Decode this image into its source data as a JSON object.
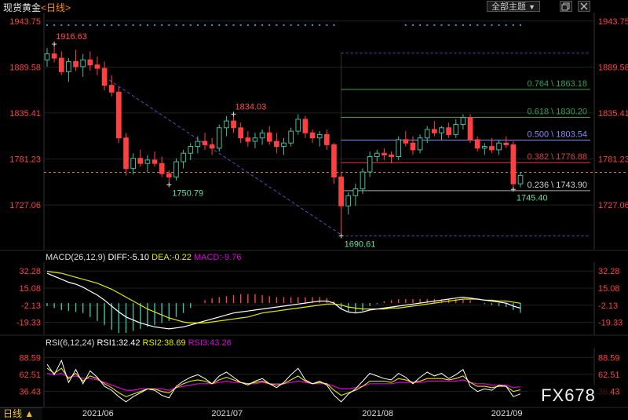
{
  "header": {
    "title": "现货黄金",
    "timeframe_link": "<日线>",
    "theme_label": "全部主题",
    "dropdown_glyph": "▼",
    "window_icons": [
      "restore-icon",
      "close-icon"
    ],
    "bottom_timeframe": "日线 ▲",
    "watermark": "FX678"
  },
  "colors": {
    "up": "#40c0a0",
    "down": "#ff4040",
    "macd_pos": "#ff4040",
    "macd_neg": "#40c0a0",
    "dif": "#ffffff",
    "dea": "#e8e800",
    "rsi1": "#ffffff",
    "rsi2": "#e8e800",
    "rsi3": "#e000e0",
    "axis_text": "#ff4040",
    "grid": "#202020"
  },
  "chart_data": [
    {
      "type": "candlestick",
      "panel": "price",
      "title": "现货黄金 <日线>",
      "y_ticks": [
        "1943.75",
        "1889.58",
        "1835.41",
        "1781.23",
        "1727.06"
      ],
      "ylim": [
        1680,
        1950
      ],
      "x_ticks": [
        "2021/06",
        "2021/07",
        "2021/08",
        "2021/09"
      ],
      "annotations": [
        {
          "label": "1916.63",
          "value": 1916.63,
          "kind": "high"
        },
        {
          "label": "1750.79",
          "value": 1750.79,
          "kind": "low"
        },
        {
          "label": "1690.61",
          "value": 1690.61,
          "kind": "low"
        },
        {
          "label": "1834.03",
          "value": 1834.03,
          "kind": "high"
        },
        {
          "label": "1745.40",
          "value": 1745.4,
          "kind": "low"
        }
      ],
      "fib_levels": [
        {
          "label": "0.764 \\ 1863.18",
          "value": 1863.18,
          "color": "#2ea35a"
        },
        {
          "label": "0.618 \\ 1830.20",
          "value": 1830.2,
          "color": "#2ea35a"
        },
        {
          "label": "0.500 \\ 1803.54",
          "value": 1803.54,
          "color": "#8a8aff"
        },
        {
          "label": "0.382 \\ 1776.88",
          "value": 1776.88,
          "color": "#e04040"
        },
        {
          "label": "0.236 \\ 1743.90",
          "value": 1743.9,
          "color": "#aaaaaa"
        }
      ],
      "fib_bounds": [
        1690.61,
        1906.0
      ],
      "current_price_line": 1765.5,
      "ohlc": [
        [
          1898,
          1912,
          1890,
          1905
        ],
        [
          1905,
          1916.6,
          1895,
          1900
        ],
        [
          1900,
          1908,
          1880,
          1884
        ],
        [
          1884,
          1900,
          1872,
          1896
        ],
        [
          1896,
          1910,
          1885,
          1890
        ],
        [
          1890,
          1905,
          1878,
          1898
        ],
        [
          1898,
          1908,
          1885,
          1892
        ],
        [
          1892,
          1902,
          1880,
          1888
        ],
        [
          1888,
          1896,
          1862,
          1868
        ],
        [
          1868,
          1880,
          1855,
          1860
        ],
        [
          1860,
          1866,
          1800,
          1806
        ],
        [
          1806,
          1812,
          1762,
          1770
        ],
        [
          1770,
          1788,
          1763,
          1782
        ],
        [
          1782,
          1792,
          1772,
          1776
        ],
        [
          1776,
          1786,
          1766,
          1780
        ],
        [
          1780,
          1790,
          1772,
          1776
        ],
        [
          1776,
          1784,
          1760,
          1764
        ],
        [
          1764,
          1768,
          1750.8,
          1760
        ],
        [
          1760,
          1782,
          1756,
          1778
        ],
        [
          1778,
          1792,
          1770,
          1788
        ],
        [
          1788,
          1800,
          1780,
          1796
        ],
        [
          1796,
          1808,
          1788,
          1802
        ],
        [
          1802,
          1812,
          1792,
          1798
        ],
        [
          1798,
          1806,
          1786,
          1794
        ],
        [
          1794,
          1822,
          1790,
          1818
        ],
        [
          1818,
          1832,
          1808,
          1826
        ],
        [
          1826,
          1834,
          1812,
          1818
        ],
        [
          1818,
          1824,
          1800,
          1806
        ],
        [
          1806,
          1814,
          1796,
          1802
        ],
        [
          1802,
          1812,
          1794,
          1806
        ],
        [
          1806,
          1816,
          1798,
          1812
        ],
        [
          1812,
          1820,
          1798,
          1802
        ],
        [
          1802,
          1812,
          1788,
          1796
        ],
        [
          1796,
          1806,
          1786,
          1800
        ],
        [
          1800,
          1818,
          1796,
          1814
        ],
        [
          1814,
          1834,
          1810,
          1828
        ],
        [
          1828,
          1832,
          1806,
          1812
        ],
        [
          1812,
          1816,
          1800,
          1806
        ],
        [
          1806,
          1814,
          1796,
          1810
        ],
        [
          1810,
          1816,
          1792,
          1798
        ],
        [
          1798,
          1800,
          1752,
          1760
        ],
        [
          1760,
          1766,
          1690.6,
          1726
        ],
        [
          1726,
          1742,
          1716,
          1738
        ],
        [
          1738,
          1752,
          1726,
          1746
        ],
        [
          1746,
          1770,
          1740,
          1766
        ],
        [
          1766,
          1790,
          1760,
          1784
        ],
        [
          1784,
          1792,
          1778,
          1788
        ],
        [
          1788,
          1794,
          1780,
          1786
        ],
        [
          1786,
          1790,
          1776,
          1784
        ],
        [
          1784,
          1808,
          1780,
          1804
        ],
        [
          1804,
          1814,
          1796,
          1800
        ],
        [
          1800,
          1808,
          1786,
          1792
        ],
        [
          1792,
          1810,
          1788,
          1806
        ],
        [
          1806,
          1820,
          1800,
          1816
        ],
        [
          1816,
          1826,
          1808,
          1812
        ],
        [
          1812,
          1820,
          1804,
          1818
        ],
        [
          1818,
          1824,
          1806,
          1810
        ],
        [
          1810,
          1828,
          1806,
          1822
        ],
        [
          1822,
          1834,
          1816,
          1830
        ],
        [
          1830,
          1834,
          1800,
          1804
        ],
        [
          1804,
          1808,
          1790,
          1794
        ],
        [
          1794,
          1800,
          1786,
          1796
        ],
        [
          1796,
          1806,
          1788,
          1792
        ],
        [
          1792,
          1804,
          1786,
          1800
        ],
        [
          1800,
          1808,
          1794,
          1798
        ],
        [
          1798,
          1802,
          1745.4,
          1752
        ],
        [
          1752,
          1766,
          1748,
          1762
        ]
      ]
    },
    {
      "type": "macd",
      "panel": "macd",
      "title": "MACD(26,12,9)",
      "labels": [
        "DIFF:-5.10",
        "DEA:-0.22",
        "MACD:-9.76"
      ],
      "y_ticks": [
        "32.28",
        "15.08",
        "-2.13",
        "-19.33"
      ],
      "ylim": [
        -30,
        38
      ],
      "diff": [
        30,
        27,
        24,
        21,
        19,
        16,
        12,
        8,
        3,
        -3,
        -9,
        -14,
        -17,
        -20,
        -22,
        -24,
        -25,
        -26,
        -25,
        -24,
        -22,
        -20,
        -18,
        -16,
        -14,
        -12,
        -10,
        -9,
        -8,
        -7,
        -6,
        -5,
        -4,
        -3,
        -2,
        -1,
        0,
        1,
        2,
        2,
        0,
        -6,
        -9,
        -10,
        -9,
        -7,
        -6,
        -5,
        -4,
        -3,
        -2,
        -1,
        0,
        1,
        2,
        3,
        4,
        5,
        6,
        5,
        4,
        3,
        2,
        1,
        0,
        -3,
        -5.1
      ],
      "dea": [
        32,
        31,
        30,
        28,
        26,
        24,
        22,
        20,
        17,
        14,
        10,
        6,
        2,
        -2,
        -6,
        -9,
        -12,
        -15,
        -17,
        -19,
        -20,
        -20,
        -20,
        -19,
        -18,
        -17,
        -16,
        -15,
        -14,
        -12,
        -10,
        -9,
        -8,
        -7,
        -6,
        -5,
        -4,
        -3,
        -2,
        -1,
        -1,
        -2,
        -4,
        -5,
        -6,
        -6,
        -6,
        -6,
        -5,
        -5,
        -4,
        -3,
        -2,
        -1,
        0,
        1,
        2,
        3,
        4,
        4,
        4,
        3,
        3,
        2,
        2,
        1,
        -0.22
      ],
      "hist": [
        -3,
        -5,
        -7,
        -8,
        -9,
        -10,
        -14,
        -18,
        -22,
        -27,
        -30,
        -30,
        -28,
        -26,
        -24,
        -22,
        -20,
        -18,
        -14,
        -10,
        -5,
        0,
        3,
        5,
        6,
        7,
        8,
        9,
        9,
        9,
        8,
        7,
        6,
        6,
        6,
        6,
        6,
        6,
        6,
        5,
        2,
        -6,
        -9,
        -10,
        -8,
        -3,
        -1,
        2,
        3,
        4,
        4,
        4,
        4,
        4,
        4,
        4,
        4,
        4,
        4,
        3,
        0,
        -1,
        -2,
        -3,
        -4,
        -7,
        -9.76
      ]
    },
    {
      "type": "rsi",
      "panel": "rsi",
      "title": "RSI(6,12,24)",
      "labels": [
        "RSI1:32.42",
        "RSI2:38.69",
        "RSI3:43.26"
      ],
      "y_ticks": [
        "88.59",
        "62.51",
        "36.43"
      ],
      "ylim": [
        15,
        100
      ],
      "rsi1": [
        78,
        62,
        84,
        50,
        70,
        48,
        68,
        58,
        44,
        38,
        28,
        20,
        28,
        34,
        40,
        38,
        30,
        26,
        44,
        52,
        58,
        62,
        56,
        48,
        60,
        66,
        58,
        50,
        46,
        52,
        56,
        48,
        42,
        50,
        62,
        72,
        54,
        48,
        52,
        46,
        30,
        20,
        32,
        40,
        52,
        64,
        60,
        56,
        54,
        64,
        58,
        48,
        58,
        66,
        60,
        64,
        56,
        62,
        70,
        44,
        36,
        40,
        38,
        46,
        44,
        28,
        32.42
      ],
      "rsi2": [
        72,
        64,
        72,
        56,
        64,
        52,
        60,
        56,
        48,
        42,
        34,
        28,
        32,
        36,
        40,
        40,
        36,
        34,
        42,
        48,
        52,
        54,
        52,
        48,
        54,
        58,
        54,
        50,
        48,
        50,
        52,
        48,
        46,
        48,
        54,
        60,
        52,
        48,
        50,
        48,
        38,
        30,
        34,
        38,
        44,
        52,
        52,
        52,
        50,
        56,
        54,
        50,
        52,
        56,
        56,
        56,
        54,
        56,
        60,
        50,
        44,
        44,
        42,
        44,
        44,
        36,
        38.69
      ],
      "rsi3": [
        64,
        62,
        64,
        58,
        60,
        56,
        56,
        54,
        50,
        46,
        42,
        38,
        38,
        40,
        40,
        40,
        40,
        38,
        42,
        44,
        46,
        48,
        48,
        48,
        50,
        52,
        50,
        50,
        48,
        48,
        50,
        48,
        48,
        48,
        50,
        52,
        50,
        48,
        48,
        48,
        44,
        40,
        40,
        42,
        44,
        48,
        48,
        48,
        48,
        50,
        50,
        50,
        50,
        52,
        52,
        52,
        52,
        52,
        54,
        50,
        48,
        48,
        46,
        46,
        46,
        42,
        43.26
      ]
    }
  ]
}
